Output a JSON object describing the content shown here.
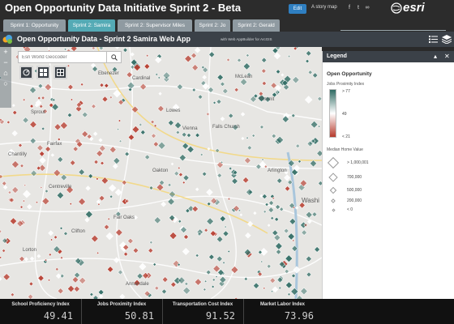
{
  "story": {
    "title": "Open Opportunity Data Initiative Sprint 2 - Beta",
    "edit_label": "Edit",
    "story_map_label": "A story map",
    "brand": "esri"
  },
  "tabs": [
    {
      "label": "Sprint 1: Opportunity",
      "active": false
    },
    {
      "label": "Sprint 2: Samira",
      "active": true
    },
    {
      "label": "Sprint 2: Supervisor Miles",
      "active": false
    },
    {
      "label": "Sprint 2: Jo",
      "active": false
    },
    {
      "label": "Sprint 2: Gerald",
      "active": false
    }
  ],
  "app": {
    "title": "Open Opportunity Data - Sprint 2 Samira Web App",
    "subtitle": "with Web AppBuilder for ArcGIS"
  },
  "map": {
    "search_placeholder": "Esri World Geocoder",
    "places": [
      "Ebenezer",
      "Cardinal",
      "Fairfax",
      "Lowes",
      "Sprout",
      "Lorton",
      "McLean",
      "Pimmit",
      "Vienna",
      "Chantilly",
      "Centreville",
      "Clifton",
      "Annandale",
      "Falls Church",
      "Washi",
      "Arlington",
      "Fair Oaks",
      "Oakton"
    ],
    "colors": {
      "high": "#2f6b63",
      "mid": "#ffffff",
      "low": "#b63a2c"
    }
  },
  "legend": {
    "title": "Legend",
    "layer": "Open Opportunity",
    "color_field": "Jobs Proximity Index",
    "ramp_labels": [
      "> 77",
      "49",
      "< 21"
    ],
    "size_field": "Median Home Value",
    "size_labels": [
      "> 1,000,001",
      "700,000",
      "500,000",
      "200,000",
      "< 0"
    ]
  },
  "footer": {
    "metrics": [
      {
        "label": "School Proficiency Index",
        "value": "49.41"
      },
      {
        "label": "Jobs Proximity Index",
        "value": "50.81"
      },
      {
        "label": "Transportation Cost Index",
        "value": "91.52"
      },
      {
        "label": "Market Labor Index",
        "value": "73.96"
      }
    ]
  }
}
